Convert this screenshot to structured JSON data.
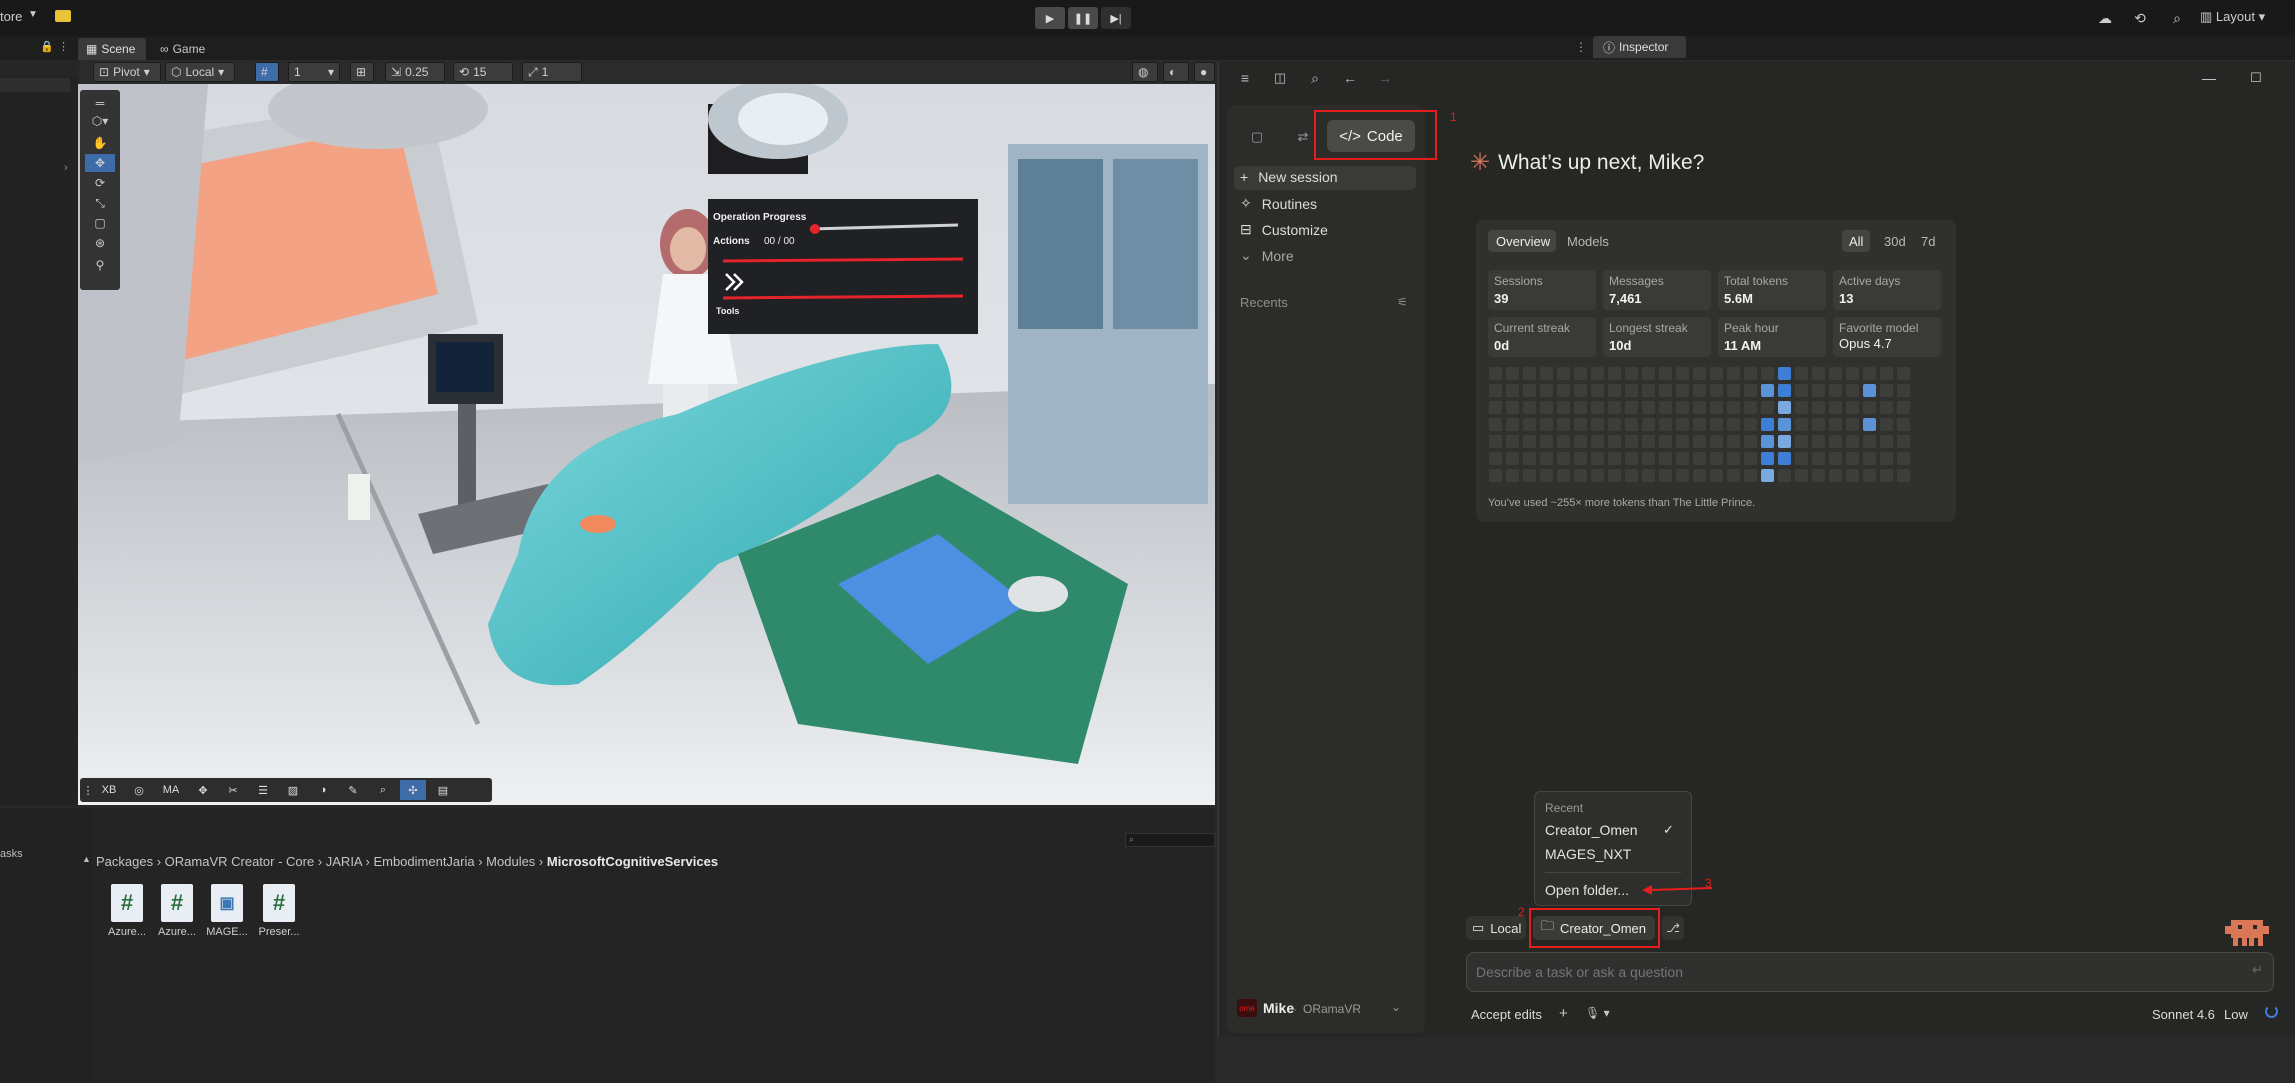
{
  "topbar": {
    "store_label": "tore",
    "layout_label": "Layout"
  },
  "tabs": {
    "scene": "Scene",
    "game": "Game",
    "inspector": "Inspector"
  },
  "scene_toolbar": {
    "pivot": "Pivot",
    "local": "Local",
    "grid_count": "1",
    "snap_value": "0.25",
    "rotate_snap": "15",
    "scale_snap": "1"
  },
  "scene_overlay": {
    "panel_title": "Operation Progress",
    "actions_label": "Actions",
    "actions_value": "00 / 00",
    "tools_label": "Tools",
    "bottom_btn_xb": "XB",
    "bottom_btn_ma": "MA"
  },
  "project": {
    "tasks_label": "asks",
    "breadcrumb": [
      "Packages",
      "ORamaVR Creator - Core",
      "JARIA",
      "EmbodimentJaria",
      "Modules",
      "MicrosoftCognitiveServices"
    ],
    "assets": [
      {
        "label": "Azure...",
        "glyph": "#"
      },
      {
        "label": "Azure...",
        "glyph": "#"
      },
      {
        "label": "MAGE...",
        "glyph": "▣"
      },
      {
        "label": "Preser...",
        "glyph": "#"
      }
    ]
  },
  "claude": {
    "code_label": "Code",
    "nav": [
      "New session",
      "Routines",
      "Customize",
      "More"
    ],
    "recents_label": "Recents",
    "headline": "What’s up next, Mike?",
    "stats_tabs": [
      "Overview",
      "Models"
    ],
    "range_tabs": [
      "All",
      "30d",
      "7d"
    ],
    "stats": [
      {
        "label": "Sessions",
        "value": "39"
      },
      {
        "label": "Messages",
        "value": "7,461"
      },
      {
        "label": "Total tokens",
        "value": "5.6M"
      },
      {
        "label": "Active days",
        "value": "13"
      },
      {
        "label": "Current streak",
        "value": "0d"
      },
      {
        "label": "Longest streak",
        "value": "10d"
      },
      {
        "label": "Peak hour",
        "value": "11 AM"
      },
      {
        "label": "Favorite model",
        "value": "Opus 4.7"
      }
    ],
    "tokens_note": "You’ve used ~255× more tokens than The Little Prince.",
    "popup": {
      "header": "Recent",
      "items": [
        "Creator_Omen",
        "MAGES_NXT"
      ],
      "open_folder": "Open folder..."
    },
    "env_local": "Local",
    "env_folder": "Creator_Omen",
    "input_placeholder": "Describe a task or ask a question",
    "accept_edits": "Accept edits",
    "model": "Sonnet 4.6",
    "effort": "Low",
    "user_name": "Mike",
    "user_org": "ORamaVR"
  },
  "annotations": [
    "1",
    "2",
    "3"
  ],
  "colors": {
    "accent_red": "#e51d1d",
    "brand_orange": "#d97757",
    "heat_blue": "#3d7fd6"
  }
}
